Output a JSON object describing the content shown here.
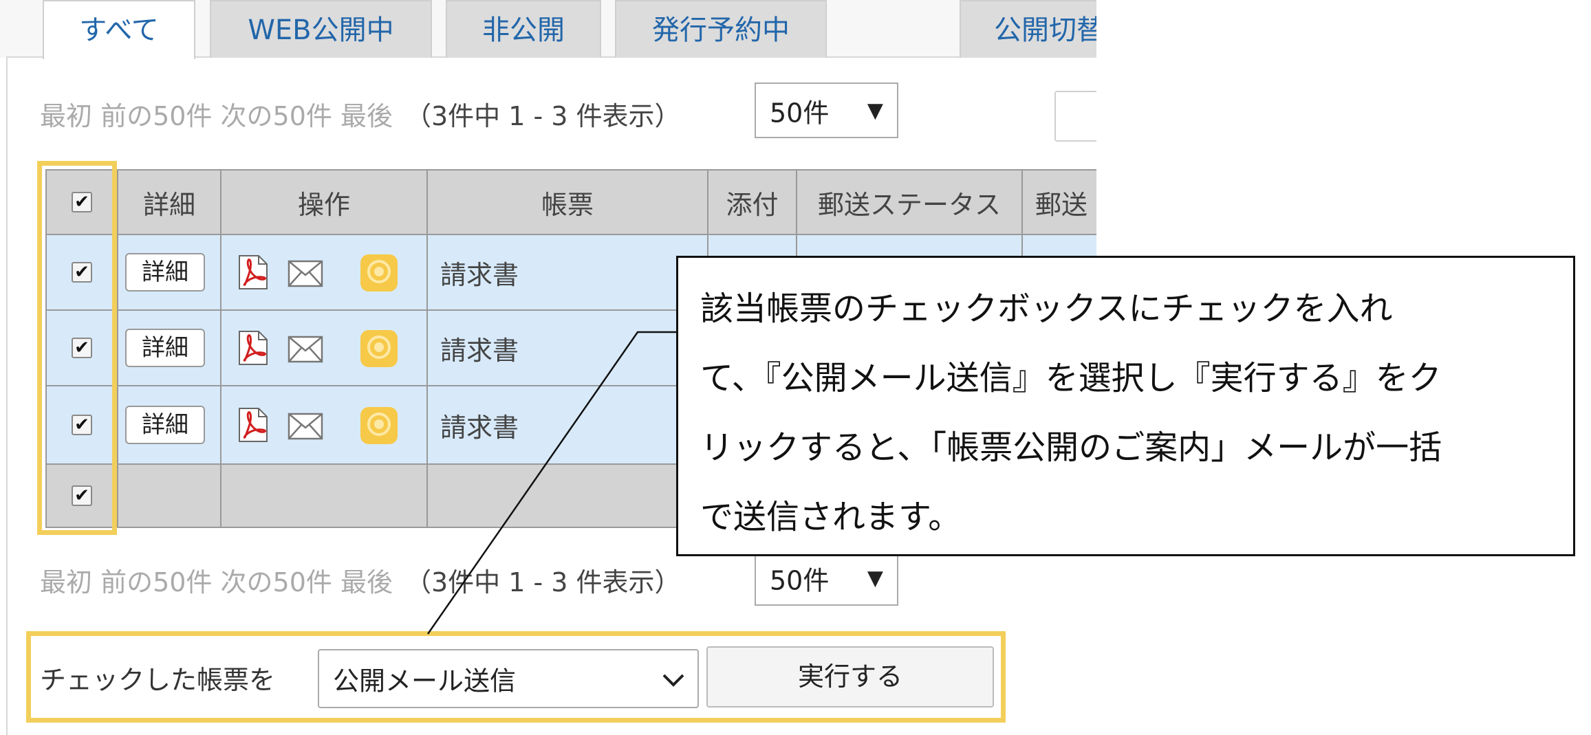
{
  "tabs": [
    {
      "label": "すべて",
      "active": true
    },
    {
      "label": "WEB公開中",
      "active": false
    },
    {
      "label": "非公開",
      "active": false
    },
    {
      "label": "発行予約中",
      "active": false
    },
    {
      "label": "公開切替",
      "active": false
    }
  ],
  "pager": {
    "nav": "最初 前の50件 次の50件 最後",
    "count": "（3件中 1 - 3 件表示）",
    "page_size": "50件"
  },
  "table": {
    "headers": {
      "detail": "詳細",
      "operation": "操作",
      "document": "帳票",
      "attachment": "添付",
      "mail_status": "郵送ステータス",
      "mail_more": "郵送"
    },
    "detail_button_label": "詳細",
    "rows": [
      {
        "checked": true,
        "document": "請求書"
      },
      {
        "checked": true,
        "document": "請求書"
      },
      {
        "checked": true,
        "document": "請求書"
      }
    ],
    "header_checked": true,
    "footer_checked": true
  },
  "bulk_action": {
    "label": "チェックした帳票を",
    "selected": "公開メール送信",
    "execute_label": "実行する"
  },
  "callout": {
    "lines": [
      "該当帳票のチェックボックスにチェックを入れ",
      "て、『公開メール送信』を選択し『実行する』をク",
      "リックすると、「帳票公開のご案内」メールが一括",
      "で送信されます。"
    ]
  },
  "colors": {
    "highlight": "#f2cf5b",
    "tab_text": "#2266aa",
    "row_bg": "#d8eafa",
    "header_bg": "#d3d3d3"
  }
}
